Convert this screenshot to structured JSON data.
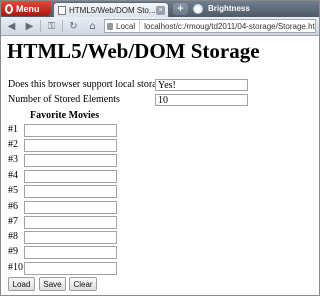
{
  "browser": {
    "menu_label": "Menu",
    "tab_title": "HTML5/Web/DOM Sto...",
    "tab_close": "×",
    "new_tab": "+",
    "brightness_label": "Brightness",
    "back_icon": "◀",
    "forward_icon": "▶",
    "key_icon": "⚿",
    "reload_icon": "↻",
    "home_icon": "⌂",
    "address_badge": "Local",
    "url": "localhost/c:/rmoug/td2011/04-storage/Storage.html"
  },
  "page": {
    "heading": "HTML5/Web/DOM Storage",
    "support_label": "Does this browser support local storage?",
    "support_value": "Yes!",
    "count_label": "Number of Stored Elements",
    "count_value": "10",
    "movies_title": "Favorite Movies",
    "movies": [
      {
        "num": "#1",
        "value": ""
      },
      {
        "num": "#2",
        "value": ""
      },
      {
        "num": "#3",
        "value": ""
      },
      {
        "num": "#4",
        "value": ""
      },
      {
        "num": "#5",
        "value": ""
      },
      {
        "num": "#6",
        "value": ""
      },
      {
        "num": "#7",
        "value": ""
      },
      {
        "num": "#8",
        "value": ""
      },
      {
        "num": "#9",
        "value": ""
      },
      {
        "num": "#10",
        "value": ""
      }
    ],
    "buttons": {
      "load": "Load",
      "save": "Save",
      "clear": "Clear"
    }
  }
}
